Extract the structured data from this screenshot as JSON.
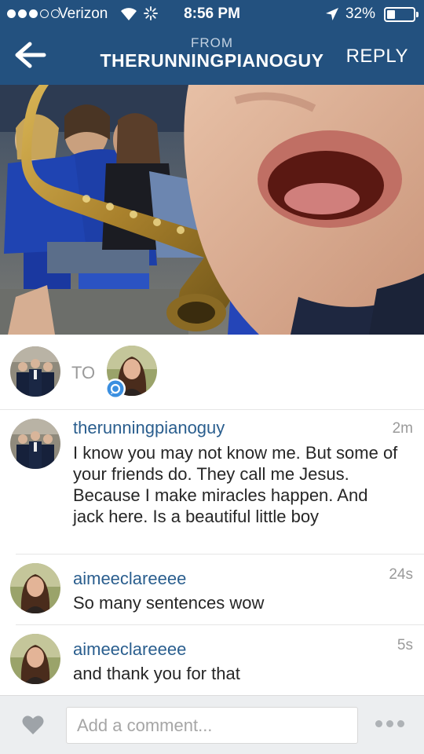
{
  "status_bar": {
    "carrier": "Verizon",
    "time": "8:56 PM",
    "battery_percent": "32%",
    "battery_level": 0.32,
    "signal_bars_filled": 3,
    "signal_bars_total": 5
  },
  "nav": {
    "from_label": "FROM",
    "from_user": "THERUNNINGPIANOGUY",
    "reply_label": "REPLY"
  },
  "recipients": {
    "to_label": "TO"
  },
  "comments": [
    {
      "username": "therunningpianoguy",
      "time": "2m",
      "text": "I know you may not know me. But some of your friends do. They call me Jesus.  Because I make miracles happen.  And jack here.  Is a beautiful little boy"
    },
    {
      "username": "aimeeclareeee",
      "time": "24s",
      "text": "So many sentences wow"
    },
    {
      "username": "aimeeclareeee",
      "time": "5s",
      "text": "and thank you for that"
    }
  ],
  "footer": {
    "comment_placeholder": "Add a comment..."
  },
  "colors": {
    "header_bg": "#23517f",
    "username": "#2a5e8e",
    "direct_badge": "#3b8fe0"
  }
}
